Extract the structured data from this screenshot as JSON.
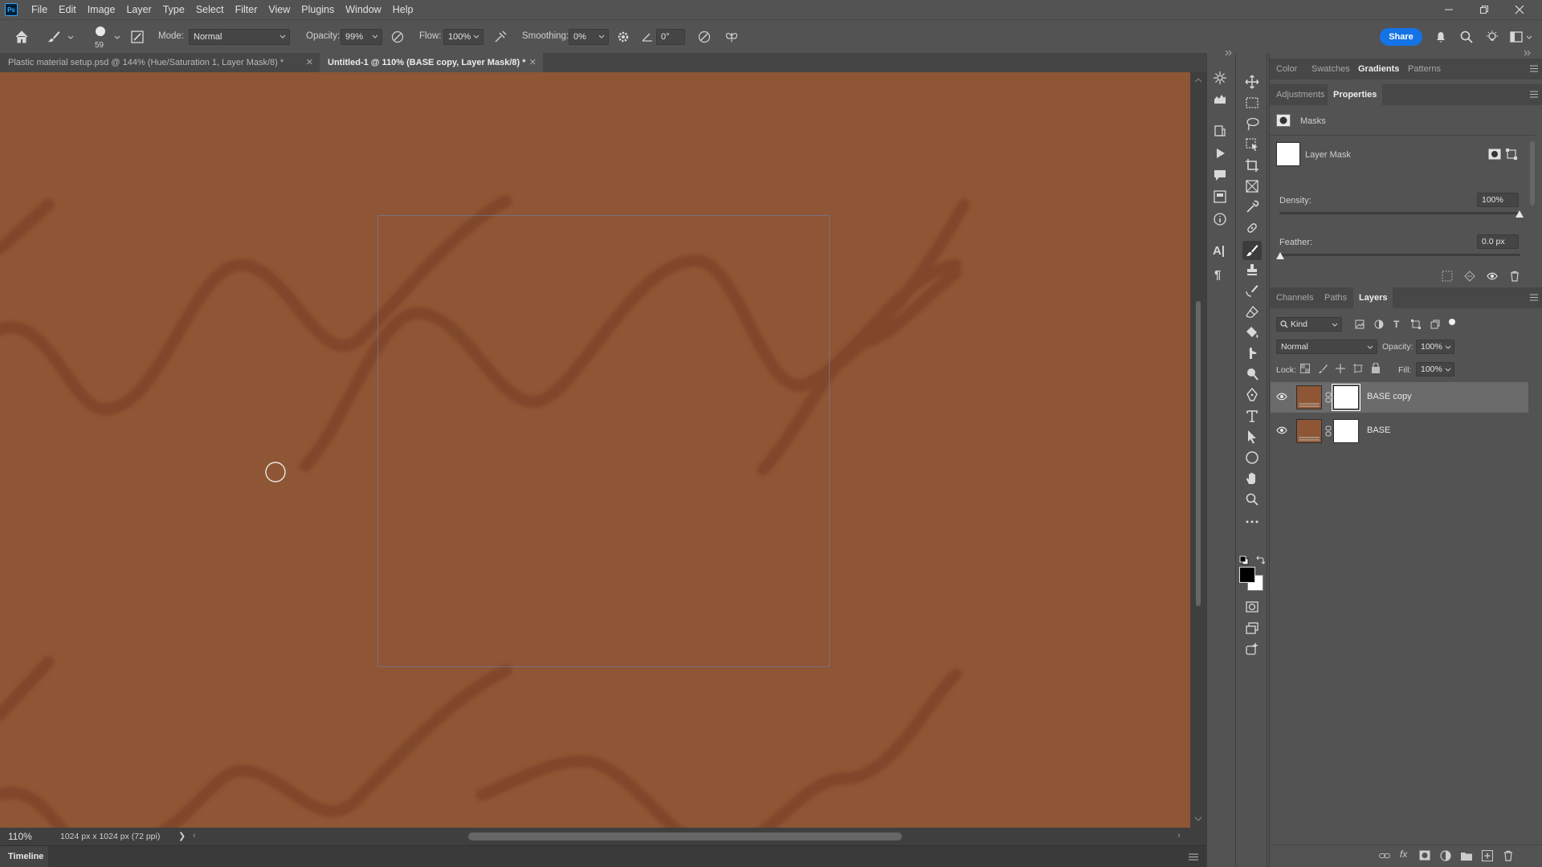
{
  "app": {
    "logo": "Ps"
  },
  "menu": [
    "File",
    "Edit",
    "Image",
    "Layer",
    "Type",
    "Select",
    "Filter",
    "View",
    "Plugins",
    "Window",
    "Help"
  ],
  "window_controls": {
    "minimize_icon": "minimize-icon",
    "restore_icon": "restore-icon",
    "close_icon": "close-icon"
  },
  "options": {
    "brush_size": "59",
    "mode_label": "Mode:",
    "mode_value": "Normal",
    "opacity_label": "Opacity:",
    "opacity_value": "99%",
    "flow_label": "Flow:",
    "flow_value": "100%",
    "smoothing_label": "Smoothing:",
    "smoothing_value": "0%",
    "angle_value": "0°",
    "share_label": "Share"
  },
  "tabs": [
    {
      "label": "Plastic material setup.psd @ 144% (Hue/Saturation 1, Layer Mask/8) *",
      "active": false
    },
    {
      "label": "Untitled-1 @ 110% (BASE copy, Layer Mask/8) *",
      "active": true
    }
  ],
  "canvas": {
    "background_color": "#8e5634",
    "stroke_color": "#7f4630"
  },
  "status": {
    "zoom": "110%",
    "doc_info": "1024 px x 1024 px (72 ppi)"
  },
  "timeline": {
    "label": "Timeline"
  },
  "top_panel": {
    "tabs": [
      "Color",
      "Swatches",
      "Gradients",
      "Patterns"
    ],
    "active": "Gradients"
  },
  "properties_panel": {
    "tabs": [
      "Adjustments",
      "Properties"
    ],
    "active": "Properties",
    "section_label": "Masks",
    "mask_label": "Layer Mask",
    "density_label": "Density:",
    "density_value": "100%",
    "feather_label": "Feather:",
    "feather_value": "0.0 px"
  },
  "layers_panel": {
    "tabs": [
      "Channels",
      "Paths",
      "Layers"
    ],
    "active": "Layers",
    "filter_kind": "Kind",
    "blend_mode": "Normal",
    "opacity_label": "Opacity:",
    "opacity_value": "100%",
    "lock_label": "Lock:",
    "fill_label": "Fill:",
    "fill_value": "100%",
    "layers": [
      {
        "name": "BASE copy",
        "selected": true,
        "visible": true
      },
      {
        "name": "BASE",
        "selected": false,
        "visible": true
      }
    ]
  },
  "colors": {
    "accent": "#1473e6",
    "foreground": "#000000",
    "background": "#ffffff"
  }
}
